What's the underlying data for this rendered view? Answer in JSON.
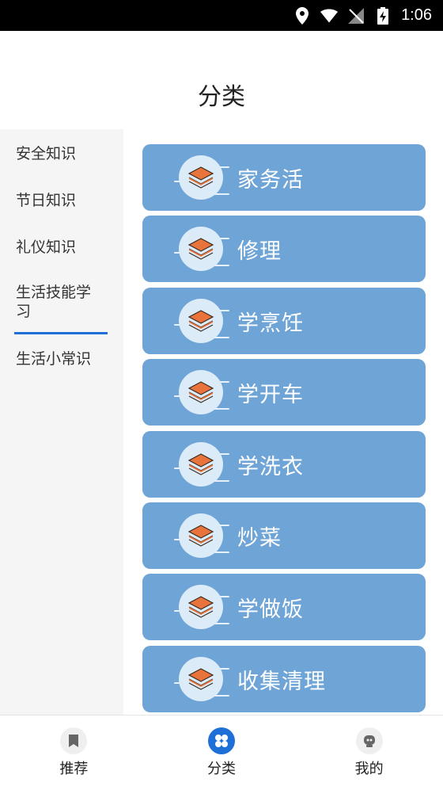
{
  "status_bar": {
    "time": "1:06"
  },
  "header": {
    "title": "分类"
  },
  "sidebar": {
    "items": [
      {
        "label": "安全知识"
      },
      {
        "label": "节日知识"
      },
      {
        "label": "礼仪知识"
      },
      {
        "label": "生活技能学习",
        "active": true
      },
      {
        "label": "生活小常识"
      }
    ]
  },
  "categories": [
    {
      "label": "家务活",
      "icon": "layers-icon"
    },
    {
      "label": "修理",
      "icon": "layers-icon"
    },
    {
      "label": "学烹饪",
      "icon": "layers-icon"
    },
    {
      "label": "学开车",
      "icon": "layers-icon"
    },
    {
      "label": "学洗衣",
      "icon": "layers-icon"
    },
    {
      "label": "炒菜",
      "icon": "layers-icon"
    },
    {
      "label": "学做饭",
      "icon": "layers-icon"
    },
    {
      "label": "收集清理",
      "icon": "layers-icon"
    }
  ],
  "bottom_nav": {
    "items": [
      {
        "label": "推荐",
        "icon": "bookmark-icon"
      },
      {
        "label": "分类",
        "icon": "category-icon",
        "active": true
      },
      {
        "label": "我的",
        "icon": "robot-face-icon"
      }
    ]
  },
  "colors": {
    "card": "#6ea4d6",
    "accent": "#1e6fd6",
    "layers_orange": "#e8743b"
  }
}
